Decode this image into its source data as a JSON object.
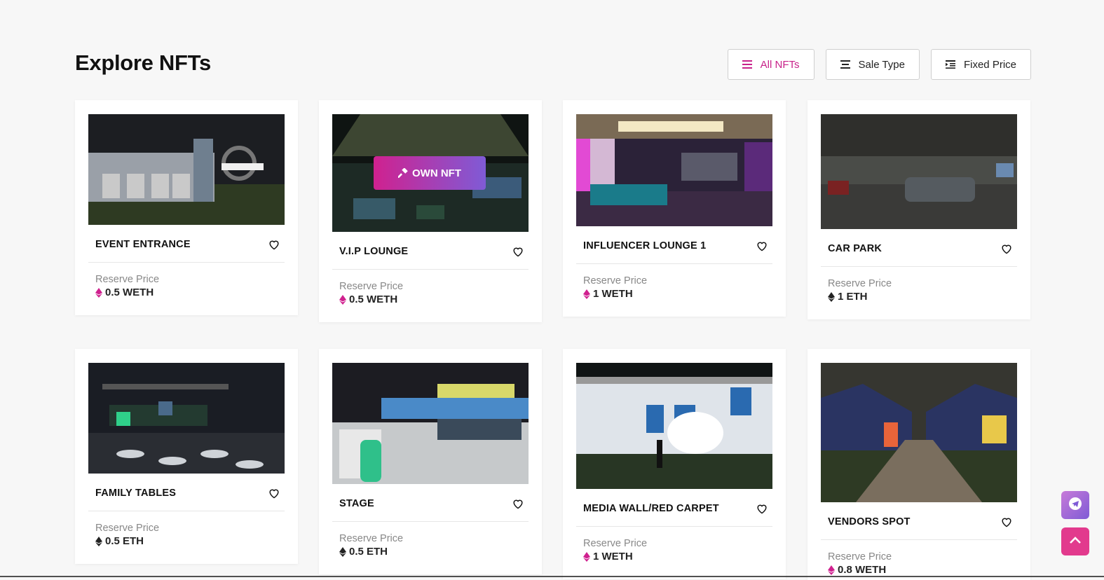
{
  "header": {
    "title": "Explore NFTs"
  },
  "filters": [
    {
      "label": "All NFTs",
      "icon": "menu-icon",
      "active": true
    },
    {
      "label": "Sale Type",
      "icon": "align-icon",
      "active": false
    },
    {
      "label": "Fixed Price",
      "icon": "indent-icon",
      "active": false
    }
  ],
  "cards": [
    {
      "name": "EVENT ENTRANCE",
      "price_label": "Reserve Price",
      "price": "0.5 WETH",
      "currency_icon": "weth-icon"
    },
    {
      "name": "V.I.P LOUNGE",
      "price_label": "Reserve Price",
      "price": "0.5 WETH",
      "currency_icon": "weth-icon",
      "hover_button": "OWN NFT"
    },
    {
      "name": "INFLUENCER LOUNGE 1",
      "price_label": "Reserve Price",
      "price": "1 WETH",
      "currency_icon": "weth-icon"
    },
    {
      "name": "CAR PARK",
      "price_label": "Reserve Price",
      "price": "1 ETH",
      "currency_icon": "eth-icon"
    },
    {
      "name": "FAMILY TABLES",
      "price_label": "Reserve Price",
      "price": "0.5 ETH",
      "currency_icon": "eth-icon"
    },
    {
      "name": "STAGE",
      "price_label": "Reserve Price",
      "price": "0.5 ETH",
      "currency_icon": "eth-icon"
    },
    {
      "name": "MEDIA WALL/RED CARPET",
      "price_label": "Reserve Price",
      "price": "1 WETH",
      "currency_icon": "weth-icon"
    },
    {
      "name": "VENDORS SPOT",
      "price_label": "Reserve Price",
      "price": "0.8 WETH",
      "currency_icon": "weth-icon"
    }
  ],
  "colors": {
    "accent": "#c8228a",
    "weth": "#d0218f",
    "eth": "#222222"
  },
  "floating": {
    "telegram_icon": "telegram-icon",
    "top_icon": "chevron-up-icon"
  }
}
